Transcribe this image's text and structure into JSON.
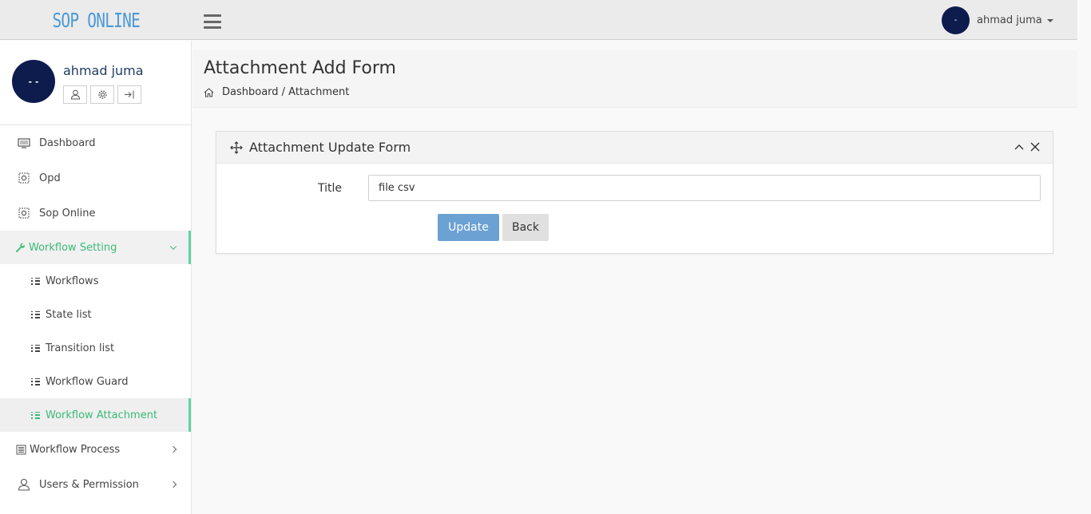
{
  "brand": "SOP ONLINE",
  "topbar": {
    "avatar_text": "-",
    "user_name": "ahmad juma"
  },
  "profile": {
    "avatar_text": "- -",
    "name": "ahmad juma"
  },
  "menu": {
    "dashboard": "Dashboard",
    "opd": "Opd",
    "sop_online": "Sop Online",
    "workflow_setting": "Workflow Setting",
    "workflows": "Workflows",
    "state_list": "State list",
    "transition_list": "Transition list",
    "workflow_guard": "Workflow Guard",
    "workflow_attachment": "Workflow Attachment",
    "workflow_process": "Workflow Process",
    "users_permission": "Users & Permission"
  },
  "page": {
    "title": "Attachment Add Form",
    "breadcrumb": "Dashboard / Attachment"
  },
  "panel": {
    "title": "Attachment Update Form",
    "title_label": "Title",
    "title_value": "file csv",
    "update_label": "Update",
    "back_label": "Back"
  },
  "colors": {
    "brand": "#4a9ad8",
    "accent": "#3cba77",
    "avatar": "#0d1b4d",
    "primary_button": "#6ca1d4"
  },
  "icons": [
    "menu-icon",
    "user-icon",
    "gear-icon",
    "logout-icon",
    "monitor-icon",
    "list-icon",
    "wrench-icon",
    "home-icon",
    "move-icon",
    "chevron-up-icon",
    "close-icon"
  ]
}
